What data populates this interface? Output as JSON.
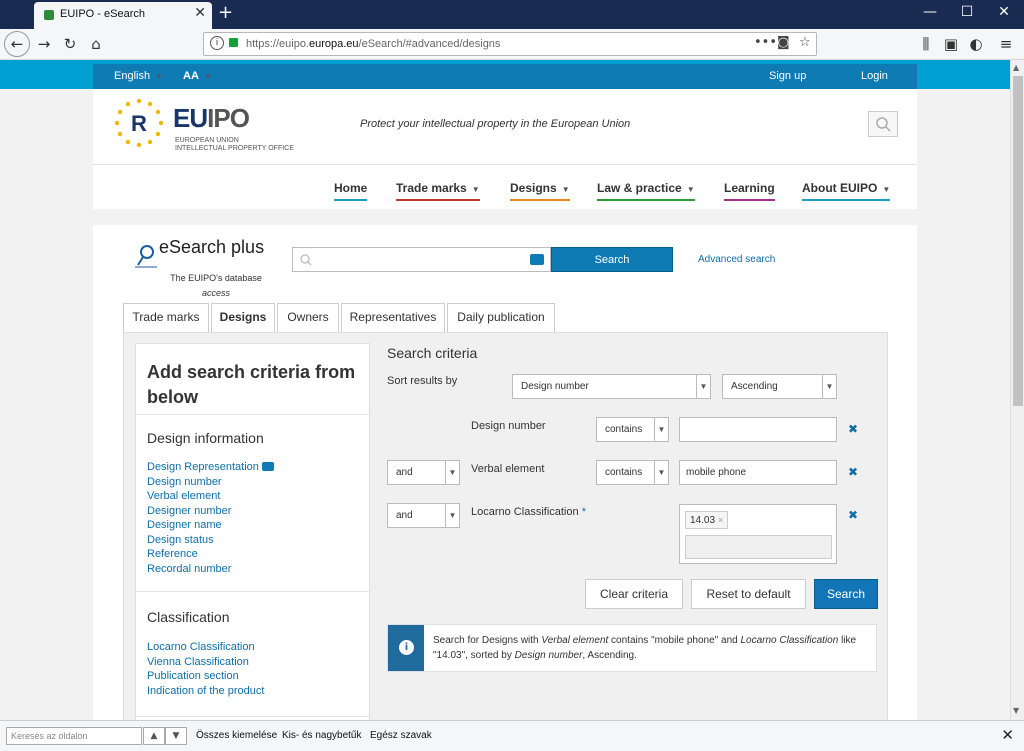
{
  "browser": {
    "tab_title": "EUIPO - eSearch",
    "tab_close": "✕",
    "new_tab": "+",
    "url_prefix": "https://euipo.",
    "url_domain": "europa.eu",
    "url_suffix": "/eSearch/#advanced/designs",
    "url_more": "•••",
    "window": {
      "minimize": "—",
      "maximize": "☐",
      "close": "✕"
    }
  },
  "topstrip": {
    "language": "English",
    "font_size": "AA",
    "sign_up": "Sign up",
    "login": "Login"
  },
  "header": {
    "logo_main_a": "EU",
    "logo_main_b": "IPO",
    "logo_sub1": "EUROPEAN UNION",
    "logo_sub2": "INTELLECTUAL PROPERTY OFFICE",
    "tagline": "Protect your intellectual property in the European Union"
  },
  "mainnav": [
    {
      "label": "Home",
      "color": "#1a9ec8"
    },
    {
      "label": "Trade marks",
      "color": "#c0392b"
    },
    {
      "label": "Designs",
      "color": "#e88a1a"
    },
    {
      "label": "Law & practice",
      "color": "#2e9b3a"
    },
    {
      "label": "Learning",
      "color": "#a02f8a"
    },
    {
      "label": "About EUIPO",
      "color": "#1a9ec8"
    }
  ],
  "esearch": {
    "title": "eSearch plus",
    "subtitle1": "The EUIPO's database",
    "subtitle2": "access",
    "search_button": "Search",
    "advanced_link": "Advanced search"
  },
  "tabs": [
    "Trade marks",
    "Designs",
    "Owners",
    "Representatives",
    "Daily publication"
  ],
  "left": {
    "heading": "Add search criteria from below",
    "design_info_title": "Design information",
    "design_info_links": [
      "Design Representation",
      "Design number",
      "Verbal element",
      "Designer number",
      "Designer name",
      "Design status",
      "Reference",
      "Recordal number"
    ],
    "classification_title": "Classification",
    "classification_links": [
      "Locarno Classification",
      "Vienna Classification",
      "Publication section",
      "Indication of the product"
    ]
  },
  "criteria": {
    "title": "Search criteria",
    "sort_label": "Sort results by",
    "sort_field": "Design number",
    "sort_order": "Ascending",
    "rows": [
      {
        "connector": "",
        "field": "Design number",
        "op": "contains",
        "value": ""
      },
      {
        "connector": "and",
        "field": "Verbal element",
        "op": "contains",
        "value": "mobile phone"
      },
      {
        "connector": "and",
        "field": "Locarno Classification",
        "required": "*",
        "tag": "14.03"
      }
    ],
    "remove": "✖",
    "clear_button": "Clear criteria",
    "reset_button": "Reset to default",
    "search_button": "Search"
  },
  "info": {
    "icon": "i",
    "p1": "Search for Designs with ",
    "f1": "Verbal element",
    "p2": " contains \"mobile phone\" and ",
    "f2": "Locarno Classification",
    "p3": " like \"14.03\", sorted by ",
    "f3": "Design number",
    "p4": ", Ascending."
  },
  "findbar": {
    "placeholder": "Keresés az oldalon",
    "highlight_all": "Összes kiemelése",
    "match_case": "Kis- és nagybetűk",
    "whole_words": "Egész szavak",
    "close": "✕"
  }
}
